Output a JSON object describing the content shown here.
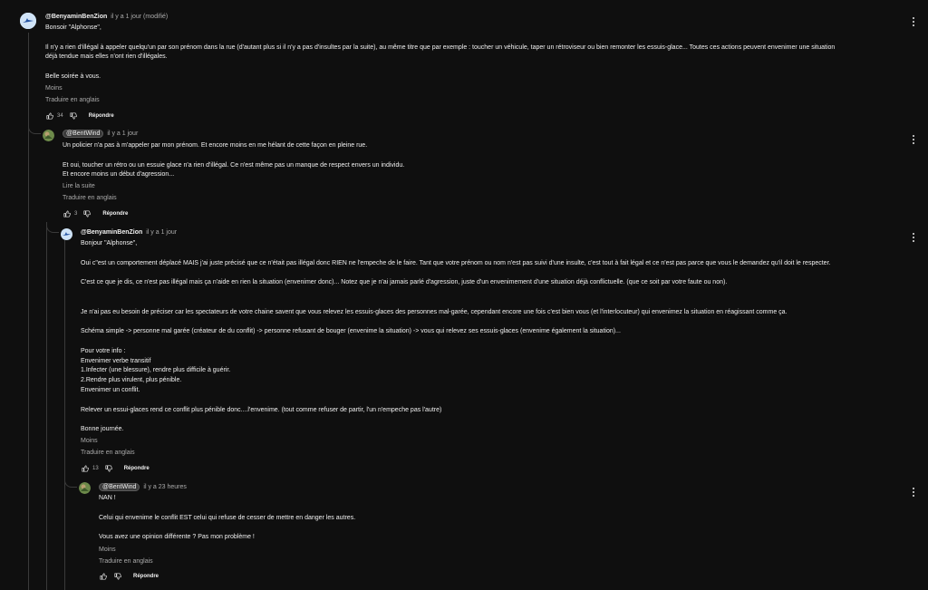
{
  "comments": [
    {
      "author": "@BenyaminBenZion",
      "meta": "il y a 1 jour (modifié)",
      "lines": [
        "Bonsoir \"Alphonse\",",
        "",
        "Il n'y a rien d'illégal à appeler quelqu'un par son prénom dans la rue (d'autant plus si il n'y a pas d'insultes par la suite),  au même titre que par exemple : toucher un véhicule, taper un rétroviseur ou bien remonter les essuis-glace... Toutes ces actions peuvent envenimer une situation",
        "déjà tendue mais elles n'ont rien d'illégales.",
        "",
        "Belle soirée à vous."
      ],
      "more": "Moins",
      "translate": "Traduire en anglais",
      "likes": "34",
      "reply": "Répondre"
    },
    {
      "author": "@BentWind",
      "meta": "il y a 1 jour",
      "lines": [
        "Un policier n'a pas à m'appeler par mon prénom. Et encore moins en me hélant de cette façon en pleine rue.",
        "",
        "Et oui, toucher un rétro ou un essuie glace n'a rien d'illégal. Ce n'est même pas un manque de respect envers un individu.",
        "Et encore moins un début d'agression..."
      ],
      "more": "Lire la suite",
      "translate": "Traduire en anglais",
      "likes": "3",
      "reply": "Répondre"
    },
    {
      "author": "@BenyaminBenZion",
      "meta": "il y a 1 jour",
      "lines": [
        "Bonjour \"Alphonse\",",
        "",
        "Oui c\"est un comportement déplacé MAIS j'ai juste précisé que ce n'était pas illégal donc RIEN ne l'empeche de le faire. Tant que votre prénom ou nom n'est pas suivi d'une insulte, c'est tout à fait légal et ce n'est pas parce que vous le demandez qu'il doit le respecter.",
        "",
        "C'est ce que je dis, ce n'est pas illégal mais ça n'aide en rien la situation (envenimer donc)... Notez que je n'ai jamais parlé d'agression, juste d'un envenimement d'une situation déjà conflictuelle. (que ce soit par votre faute ou non).",
        "",
        "",
        "Je n'ai pas eu besoin de préciser car les spectateurs de votre chaine savent que vous relevez les essuis-glaces des personnes mal-garée, cependant encore une fois c'est bien vous (et l'interlocuteur) qui envenimez la situation en réagissant comme ça.",
        "",
        "Schéma simple -> personne mal garée (créateur de du conflit) -> personne refusant de bouger (envenime la situation) -> vous qui relevez ses essuis-glaces (envenime également la situation)...",
        "",
        "Pour votre info :",
        "Envenimer verbe transitif",
        "1.Infecter (une blessure), rendre plus difficile à guérir.",
        "2.Rendre plus virulent, plus pénible.",
        "Envenimer un conflit.",
        "",
        "Relever un essui-glaces rend ce conflit plus pénible donc....l'envenime. (tout comme refuser de partir, l'un n'empeche pas l'autre)",
        "",
        "Bonne journée."
      ],
      "more": "Moins",
      "translate": "Traduire en anglais",
      "likes": "13",
      "reply": "Répondre"
    },
    {
      "author": "@BentWind",
      "meta": "il y a 23 heures",
      "lines": [
        "NAN !",
        "",
        "Celui qui envenime le conflit EST celui qui refuse de cesser de mettre en danger les autres.",
        "",
        "Vous avez une opinion différente ? Pas mon problème !"
      ],
      "more": "Moins",
      "translate": "Traduire en anglais",
      "likes": "",
      "reply": "Répondre"
    }
  ]
}
